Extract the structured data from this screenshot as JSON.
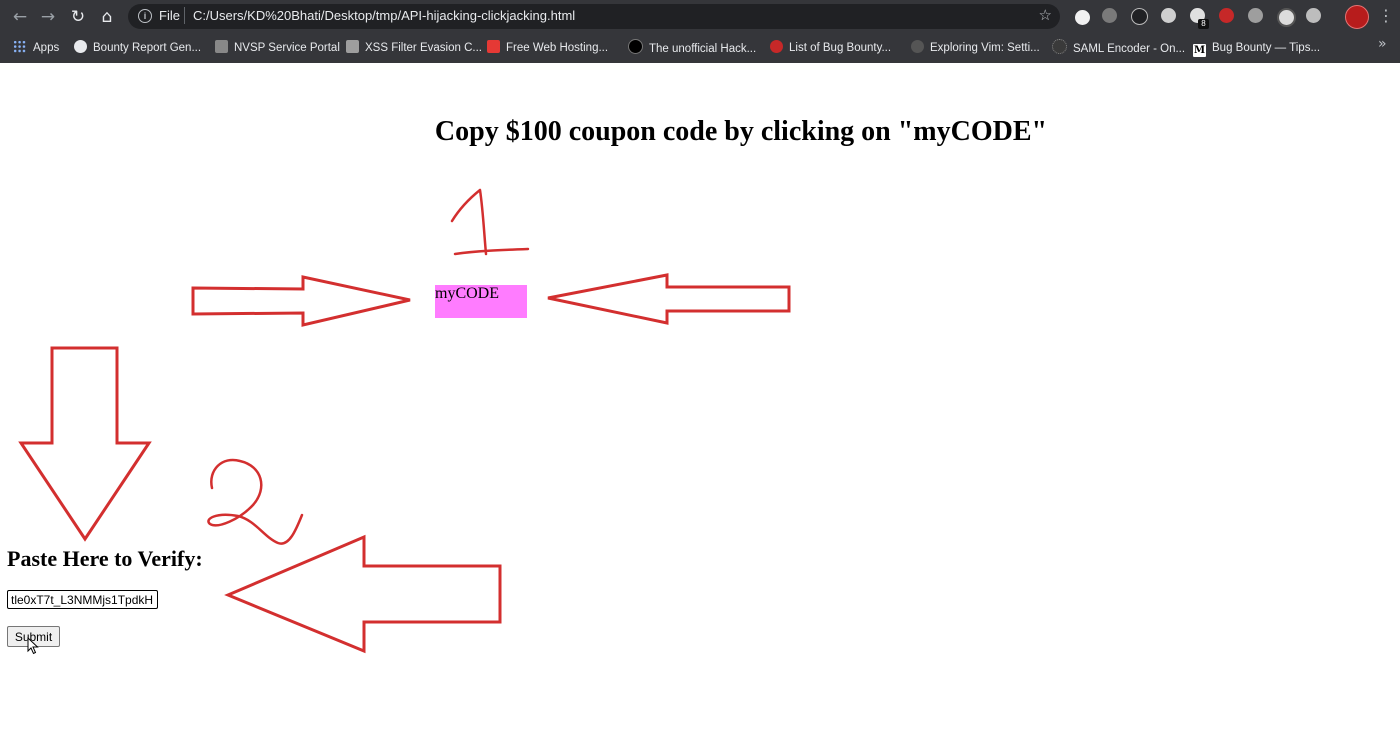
{
  "browser": {
    "nav": {
      "back_icon": "arrow-left-icon",
      "forward_icon": "arrow-right-icon",
      "reload_icon": "reload-icon",
      "home_icon": "home-icon"
    },
    "omnibox": {
      "scheme": "File",
      "url": "C:/Users/KD%20Bhati/Desktop/tmp/API-hijacking-clickjacking.html"
    },
    "extension_badge": "8",
    "bookmarks": [
      {
        "label": "Apps"
      },
      {
        "label": "Bounty Report Gen..."
      },
      {
        "label": "NVSP Service Portal"
      },
      {
        "label": "XSS Filter Evasion C..."
      },
      {
        "label": "Free Web Hosting..."
      },
      {
        "label": "The unofficial Hack..."
      },
      {
        "label": "List of Bug Bounty..."
      },
      {
        "label": "Exploring Vim: Setti..."
      },
      {
        "label": "SAML Encoder - On..."
      },
      {
        "label": "Bug Bounty — Tips..."
      }
    ]
  },
  "page": {
    "title": "Copy $100 coupon code by clicking on \"myCODE\"",
    "code_button_label": "myCODE",
    "verify_label": "Paste Here to Verify:",
    "code_input_value": "tle0xT7t_L3NMMjs1TpdkH",
    "submit_label": "Submit"
  },
  "annotations": {
    "step_1": "1",
    "step_2": "2",
    "color": "#d32f2f"
  },
  "colors": {
    "code_button_bg": "#ff7cff",
    "browser_bg": "#35363a"
  }
}
